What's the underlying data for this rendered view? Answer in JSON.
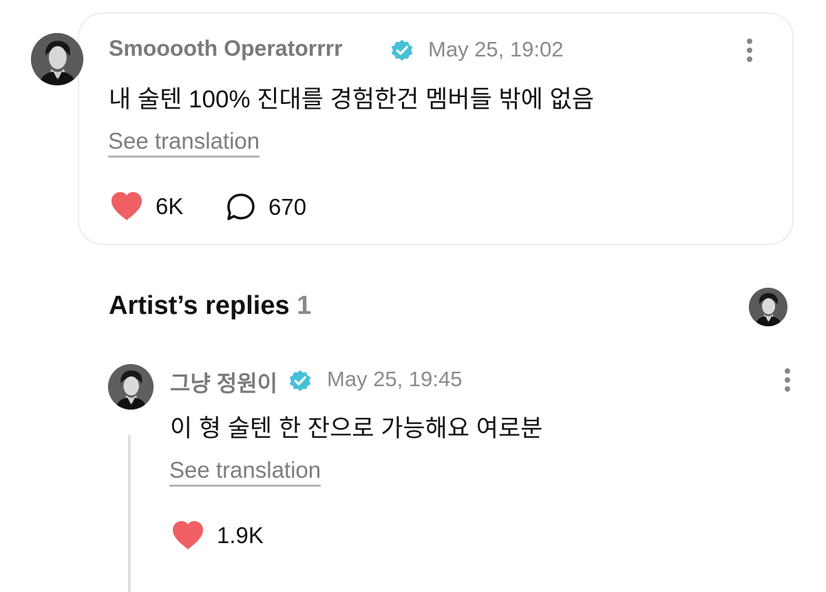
{
  "post": {
    "author": "Smooooth Operatorrrr",
    "timestamp": "May 25, 19:02",
    "text": "내 술텐 100% 진대를 경험한건 멤버들 밖에 없음",
    "see_translation": "See translation",
    "likes": "6K",
    "comments": "670"
  },
  "artist_replies": {
    "title": "Artist’s replies",
    "count": "1"
  },
  "reply": {
    "author": "그냥 정원이",
    "timestamp": "May 25, 19:45",
    "text": "이 형 술텐 한 잔으로 가능해요 여로분",
    "see_translation": "See translation",
    "likes": "1.9K"
  },
  "colors": {
    "verified": "#45c0d6",
    "heart": "#ef5f63",
    "muted_text": "#8a8a8a"
  },
  "icons": {
    "verified": "verified-badge-icon",
    "heart": "heart-icon",
    "comment": "comment-bubble-icon",
    "more": "more-vertical-icon"
  }
}
